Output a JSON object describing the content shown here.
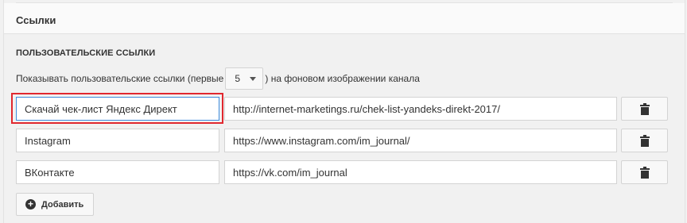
{
  "section": {
    "title": "Ссылки"
  },
  "custom_links": {
    "heading": "ПОЛЬЗОВАТЕЛЬСКИЕ ССЫЛКИ",
    "show_prefix": "Показывать пользовательские ссылки (первые",
    "show_count": "5",
    "show_suffix": ") на фоновом изображении канала",
    "rows": [
      {
        "title": "Скачай чек-лист Яндекс Директ",
        "url": "http://internet-marketings.ru/chek-list-yandeks-direkt-2017/"
      },
      {
        "title": "Instagram",
        "url": "https://www.instagram.com/im_journal/"
      },
      {
        "title": "ВКонтакте",
        "url": "https://vk.com/im_journal"
      }
    ],
    "add_label": "Добавить"
  },
  "colors": {
    "highlight": "#e0282f",
    "focus_border": "#3d8bdc"
  },
  "icons": {
    "delete": "trash-icon",
    "add": "plus-circle-icon",
    "select": "chevron-down-icon"
  }
}
